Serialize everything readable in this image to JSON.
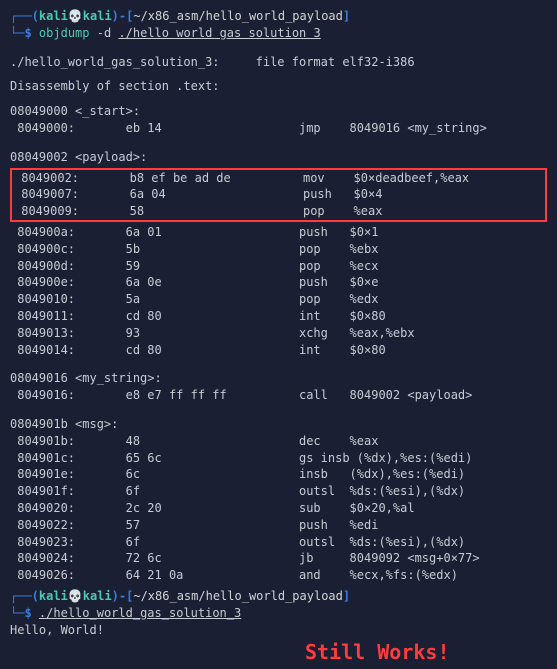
{
  "prompt1": {
    "open_paren": "┌──(",
    "user": "kali",
    "skull": "💀",
    "host": "kali",
    "close_user": ")-[",
    "path": "~/x86_asm/hello_world_payload",
    "close_path": "]",
    "dollar": "└─$",
    "cmd": "objdump",
    "flag": "-d",
    "arg": "./hello world gas solution 3"
  },
  "header": {
    "file_info": "./hello_world_gas_solution_3:     file format elf32-i386",
    "disasm": "Disassembly of section .text:"
  },
  "start": {
    "label": "08049000 <_start>:",
    "l1": " 8049000:       eb 14                   jmp    8049016 <my_string>"
  },
  "payload": {
    "label": "08049002 <payload>:",
    "boxed": [
      " 8049002:       b8 ef be ad de          mov    $0×deadbeef,%eax",
      " 8049007:       6a 04                   push   $0×4",
      " 8049009:       58                      pop    %eax"
    ],
    "rest": [
      " 804900a:       6a 01                   push   $0×1",
      " 804900c:       5b                      pop    %ebx",
      " 804900d:       59                      pop    %ecx",
      " 804900e:       6a 0e                   push   $0×e",
      " 8049010:       5a                      pop    %edx",
      " 8049011:       cd 80                   int    $0×80",
      " 8049013:       93                      xchg   %eax,%ebx",
      " 8049014:       cd 80                   int    $0×80"
    ]
  },
  "mystring": {
    "label": "08049016 <my_string>:",
    "l1": " 8049016:       e8 e7 ff ff ff          call   8049002 <payload>"
  },
  "msg": {
    "label": "0804901b <msg>:",
    "lines": [
      " 804901b:       48                      dec    %eax",
      " 804901c:       65 6c                   gs insb (%dx),%es:(%edi)",
      " 804901e:       6c                      insb   (%dx),%es:(%edi)",
      " 804901f:       6f                      outsl  %ds:(%esi),(%dx)",
      " 8049020:       2c 20                   sub    $0×20,%al",
      " 8049022:       57                      push   %edi",
      " 8049023:       6f                      outsl  %ds:(%esi),(%dx)",
      " 8049024:       72 6c                   jb     8049092 <msg+0×77>",
      " 8049026:       64 21 0a                and    %ecx,%fs:(%edx)"
    ]
  },
  "prompt2": {
    "open_paren": "┌──(",
    "user": "kali",
    "skull": "💀",
    "host": "kali",
    "close_user": ")-[",
    "path": "~/x86_asm/hello_world_payload",
    "close_path": "]",
    "dollar": "└─$",
    "cmd": "./hello_world_gas_solution_3"
  },
  "output": "Hello, World!",
  "annotation": "Still Works!"
}
